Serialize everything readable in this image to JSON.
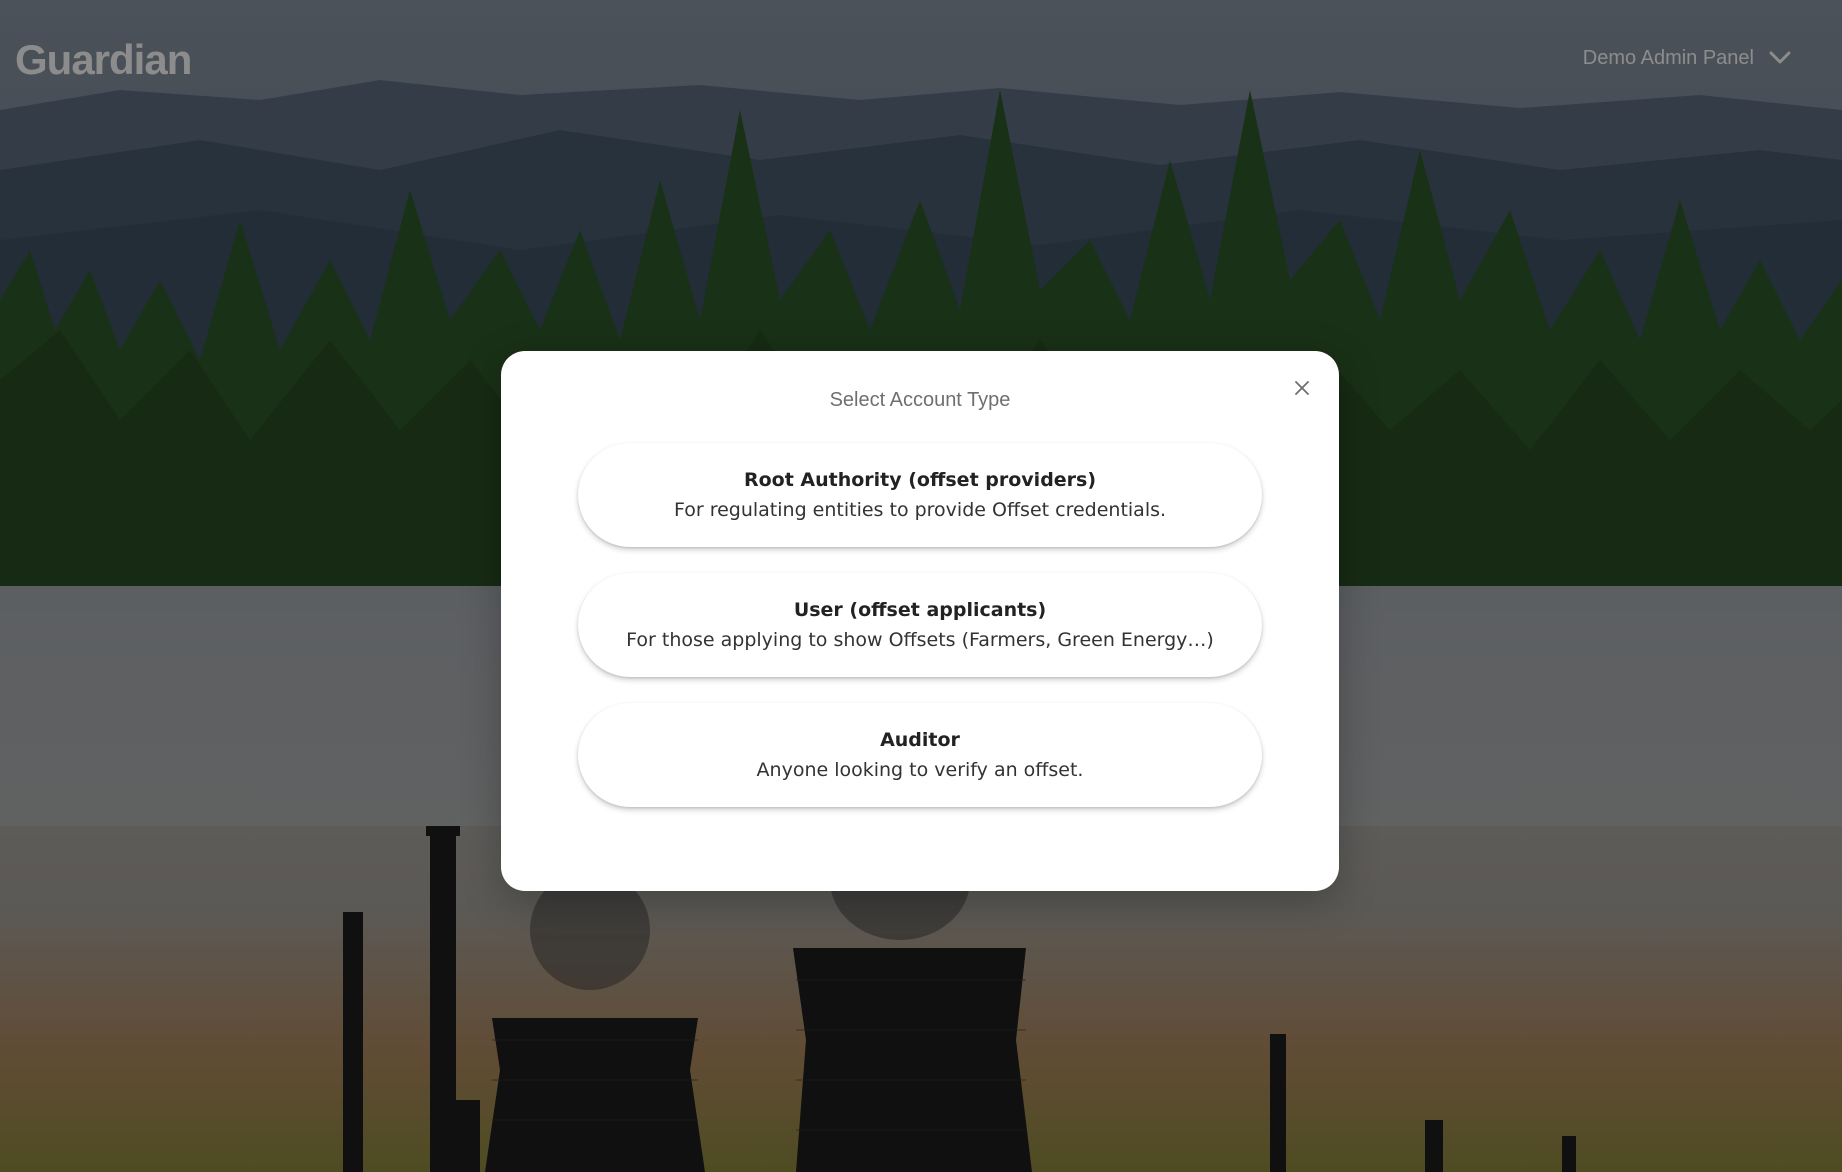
{
  "header": {
    "logo_text": "Guardian",
    "admin_panel_label": "Demo Admin Panel",
    "admin_panel_icon": "chevron-down-icon"
  },
  "dialog": {
    "title": "Select Account Type",
    "close_icon": "close-icon",
    "options": [
      {
        "title": "Root Authority (offset providers)",
        "description": "For regulating entities to provide Offset credentials."
      },
      {
        "title": "User (offset applicants)",
        "description": "For those applying to show Offsets (Farmers, Green Energy…)"
      },
      {
        "title": "Auditor",
        "description": "Anyone looking to verify an offset."
      }
    ]
  },
  "colors": {
    "overlay": "#000000",
    "dialog_background": "#ffffff",
    "title_text": "#6f6f6f",
    "option_title_text": "#222222"
  }
}
